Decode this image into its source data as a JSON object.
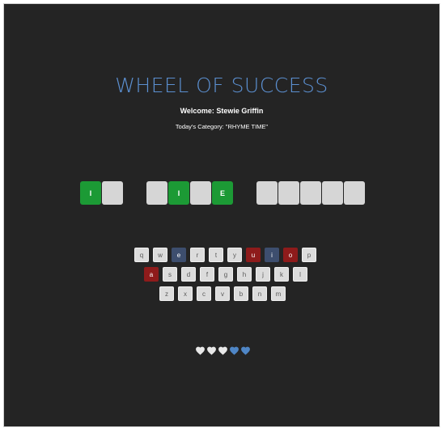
{
  "game": {
    "title": "WHEEL OF SUCCESS",
    "welcome": "Welcome: Stewie Griffin",
    "category": "Today's Category: \"RHYME TIME\""
  },
  "puzzle": {
    "words": [
      [
        {
          "letter": "I",
          "revealed": true
        },
        {
          "letter": "",
          "revealed": false
        }
      ],
      [
        {
          "letter": "",
          "revealed": false
        },
        {
          "letter": "I",
          "revealed": true
        },
        {
          "letter": "",
          "revealed": false
        },
        {
          "letter": "E",
          "revealed": true
        }
      ],
      [
        {
          "letter": "",
          "revealed": false
        },
        {
          "letter": "",
          "revealed": false
        },
        {
          "letter": "",
          "revealed": false
        },
        {
          "letter": "",
          "revealed": false
        },
        {
          "letter": "",
          "revealed": false
        }
      ]
    ]
  },
  "keyboard": {
    "rows": [
      [
        {
          "k": "q",
          "state": "unused"
        },
        {
          "k": "w",
          "state": "unused"
        },
        {
          "k": "e",
          "state": "correct"
        },
        {
          "k": "r",
          "state": "unused"
        },
        {
          "k": "t",
          "state": "unused"
        },
        {
          "k": "y",
          "state": "unused"
        },
        {
          "k": "u",
          "state": "wrong"
        },
        {
          "k": "i",
          "state": "correct"
        },
        {
          "k": "o",
          "state": "wrong"
        },
        {
          "k": "p",
          "state": "unused"
        }
      ],
      [
        {
          "k": "a",
          "state": "wrong"
        },
        {
          "k": "s",
          "state": "unused"
        },
        {
          "k": "d",
          "state": "unused"
        },
        {
          "k": "f",
          "state": "unused"
        },
        {
          "k": "g",
          "state": "unused"
        },
        {
          "k": "h",
          "state": "unused"
        },
        {
          "k": "j",
          "state": "unused"
        },
        {
          "k": "k",
          "state": "unused"
        },
        {
          "k": "l",
          "state": "unused"
        }
      ],
      [
        {
          "k": "z",
          "state": "unused"
        },
        {
          "k": "x",
          "state": "unused"
        },
        {
          "k": "c",
          "state": "unused"
        },
        {
          "k": "v",
          "state": "unused"
        },
        {
          "k": "b",
          "state": "unused"
        },
        {
          "k": "n",
          "state": "unused"
        },
        {
          "k": "m",
          "state": "unused"
        }
      ]
    ]
  },
  "lives": {
    "total": 5,
    "lost": 3,
    "lost_color": "#e8e8e8",
    "remaining_color": "#4f86c6"
  },
  "colors": {
    "title": "#5b8fd0",
    "revealed_tile": "#1c9a35",
    "hidden_tile": "#d6d6d6",
    "key_correct": "#3d4e6e",
    "key_wrong": "#8e1b1b",
    "background": "#242424"
  }
}
